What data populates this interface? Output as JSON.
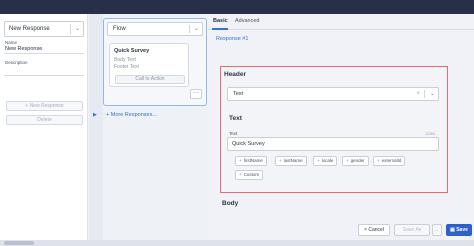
{
  "left": {
    "response_select": "New Response",
    "name_label": "Name",
    "name_value": "New Response",
    "description_label": "Description",
    "new_response_button": "+ New Response",
    "delete_button": "Delete"
  },
  "middle": {
    "flow_select": "Flow",
    "card": {
      "title": "Quick Survey",
      "body": "Body Text",
      "footer": "Footer Text",
      "cta": "Call to Action"
    },
    "more_icon": "more-dots-icon",
    "more_responses": "+ More Responses..."
  },
  "right": {
    "tabs": [
      "Basic",
      "Advanced"
    ],
    "active_tab": "Basic",
    "breadcrumb": "Response #1",
    "header_title": "Header",
    "type_value": "Text",
    "text_title": "Text",
    "text_label": "Text",
    "text_counter": "12/60",
    "text_value": "Quick Survey",
    "chips": [
      "firstName",
      "lastName",
      "locale",
      "gender",
      "externalId",
      "Custom"
    ],
    "body_title": "Body"
  },
  "footer": {
    "cancel": "Cancel",
    "save_as": "Save As",
    "save": "Save"
  },
  "colors": {
    "accent": "#2f5fcb",
    "highlight_border": "#e86a6a",
    "link": "#3a6fd1"
  }
}
